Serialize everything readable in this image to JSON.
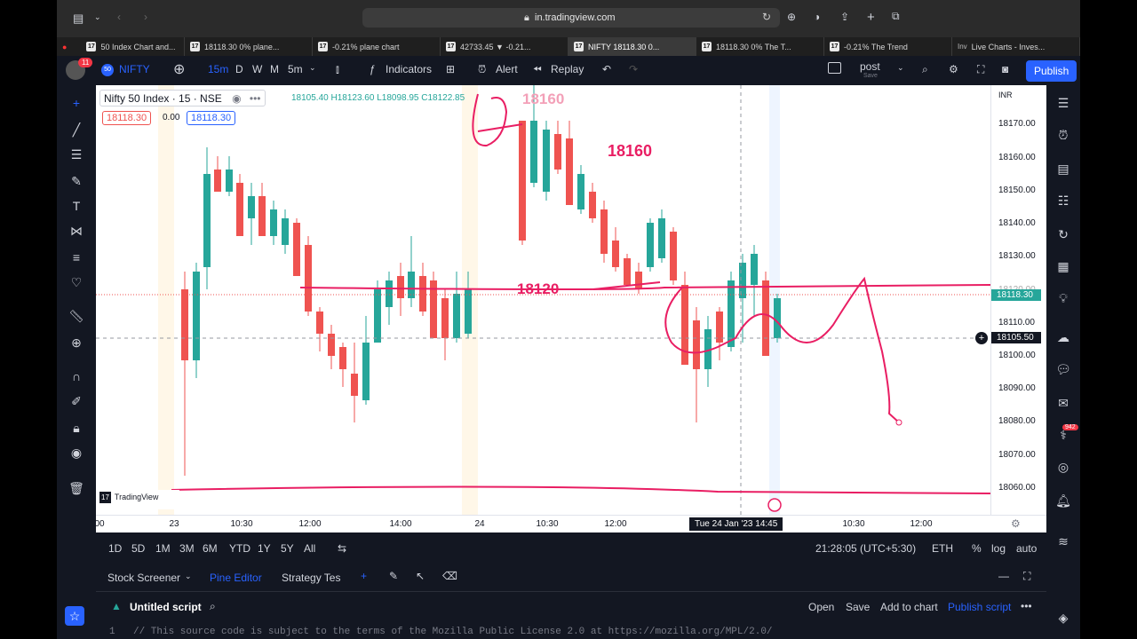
{
  "browser": {
    "url": "in.tradingview.com",
    "tabs": [
      {
        "label": "50 Index Chart and..."
      },
      {
        "label": "18118.30 0% plane..."
      },
      {
        "label": "-0.21% plane chart"
      },
      {
        "label": "42733.45 ▼ -0.21..."
      },
      {
        "label": "NIFTY 18118.30 0..."
      },
      {
        "label": "18118.30 0% The T..."
      },
      {
        "label": "-0.21% The Trend"
      },
      {
        "label": "Live Charts - Inves..."
      }
    ]
  },
  "toolbar": {
    "badge": "11",
    "symbol": "NIFTY",
    "interval": "15m",
    "intervals": [
      "D",
      "W",
      "M",
      "5m"
    ],
    "indicators": "Indicators",
    "alert": "Alert",
    "replay": "Replay",
    "layout_name": "post",
    "layout_sub": "Save",
    "publish": "Publish"
  },
  "legend": {
    "title": "Nifty 50 Index · 15 · NSE",
    "ohlc": "18105.40  H18123.60  L18098.95  C18122.85",
    "sell": "18118.30",
    "spread": "0.00",
    "buy": "18118.30"
  },
  "price_axis": {
    "currency": "INR",
    "labels": [
      "18170.00",
      "18160.00",
      "18150.00",
      "18140.00",
      "18130.00",
      "18120.00",
      "18110.00",
      "18100.00",
      "18090.00",
      "18080.00",
      "18070.00",
      "18060.00"
    ],
    "last_price": "18118.30",
    "crosshair_price": "18105.50"
  },
  "time_axis": {
    "labels": [
      "00",
      "23",
      "10:30",
      "12:00",
      "14:00",
      "24",
      "10:30",
      "12:00",
      "10:30",
      "12:00"
    ],
    "crosshair_time": "Tue 24 Jan '23  14:45"
  },
  "annotations": {
    "level_high": "18160",
    "level_mid": "18120",
    "level_top": "18160"
  },
  "watermark": "TradingView",
  "range_bar": {
    "ranges": [
      "1D",
      "5D",
      "1M",
      "3M",
      "6M",
      "YTD",
      "1Y",
      "5Y",
      "All"
    ],
    "clock": "21:28:05 (UTC+5:30)",
    "session": "ETH",
    "pct": "%",
    "log": "log",
    "auto": "auto"
  },
  "bottom_panel": {
    "tabs": [
      "Stock Screener",
      "Pine Editor",
      "Strategy Tes"
    ],
    "script_title": "Untitled script",
    "actions": [
      "Open",
      "Save",
      "Add to chart",
      "Publish script"
    ],
    "line_no": "1",
    "code_line": "// This source code is subject to the terms of the Mozilla Public License 2.0 at https://mozilla.org/MPL/2.0/"
  },
  "notification_count": "942",
  "colors": {
    "up": "#26a69a",
    "down": "#ef5350",
    "accent": "#2962ff",
    "annotation": "#e91e63"
  }
}
